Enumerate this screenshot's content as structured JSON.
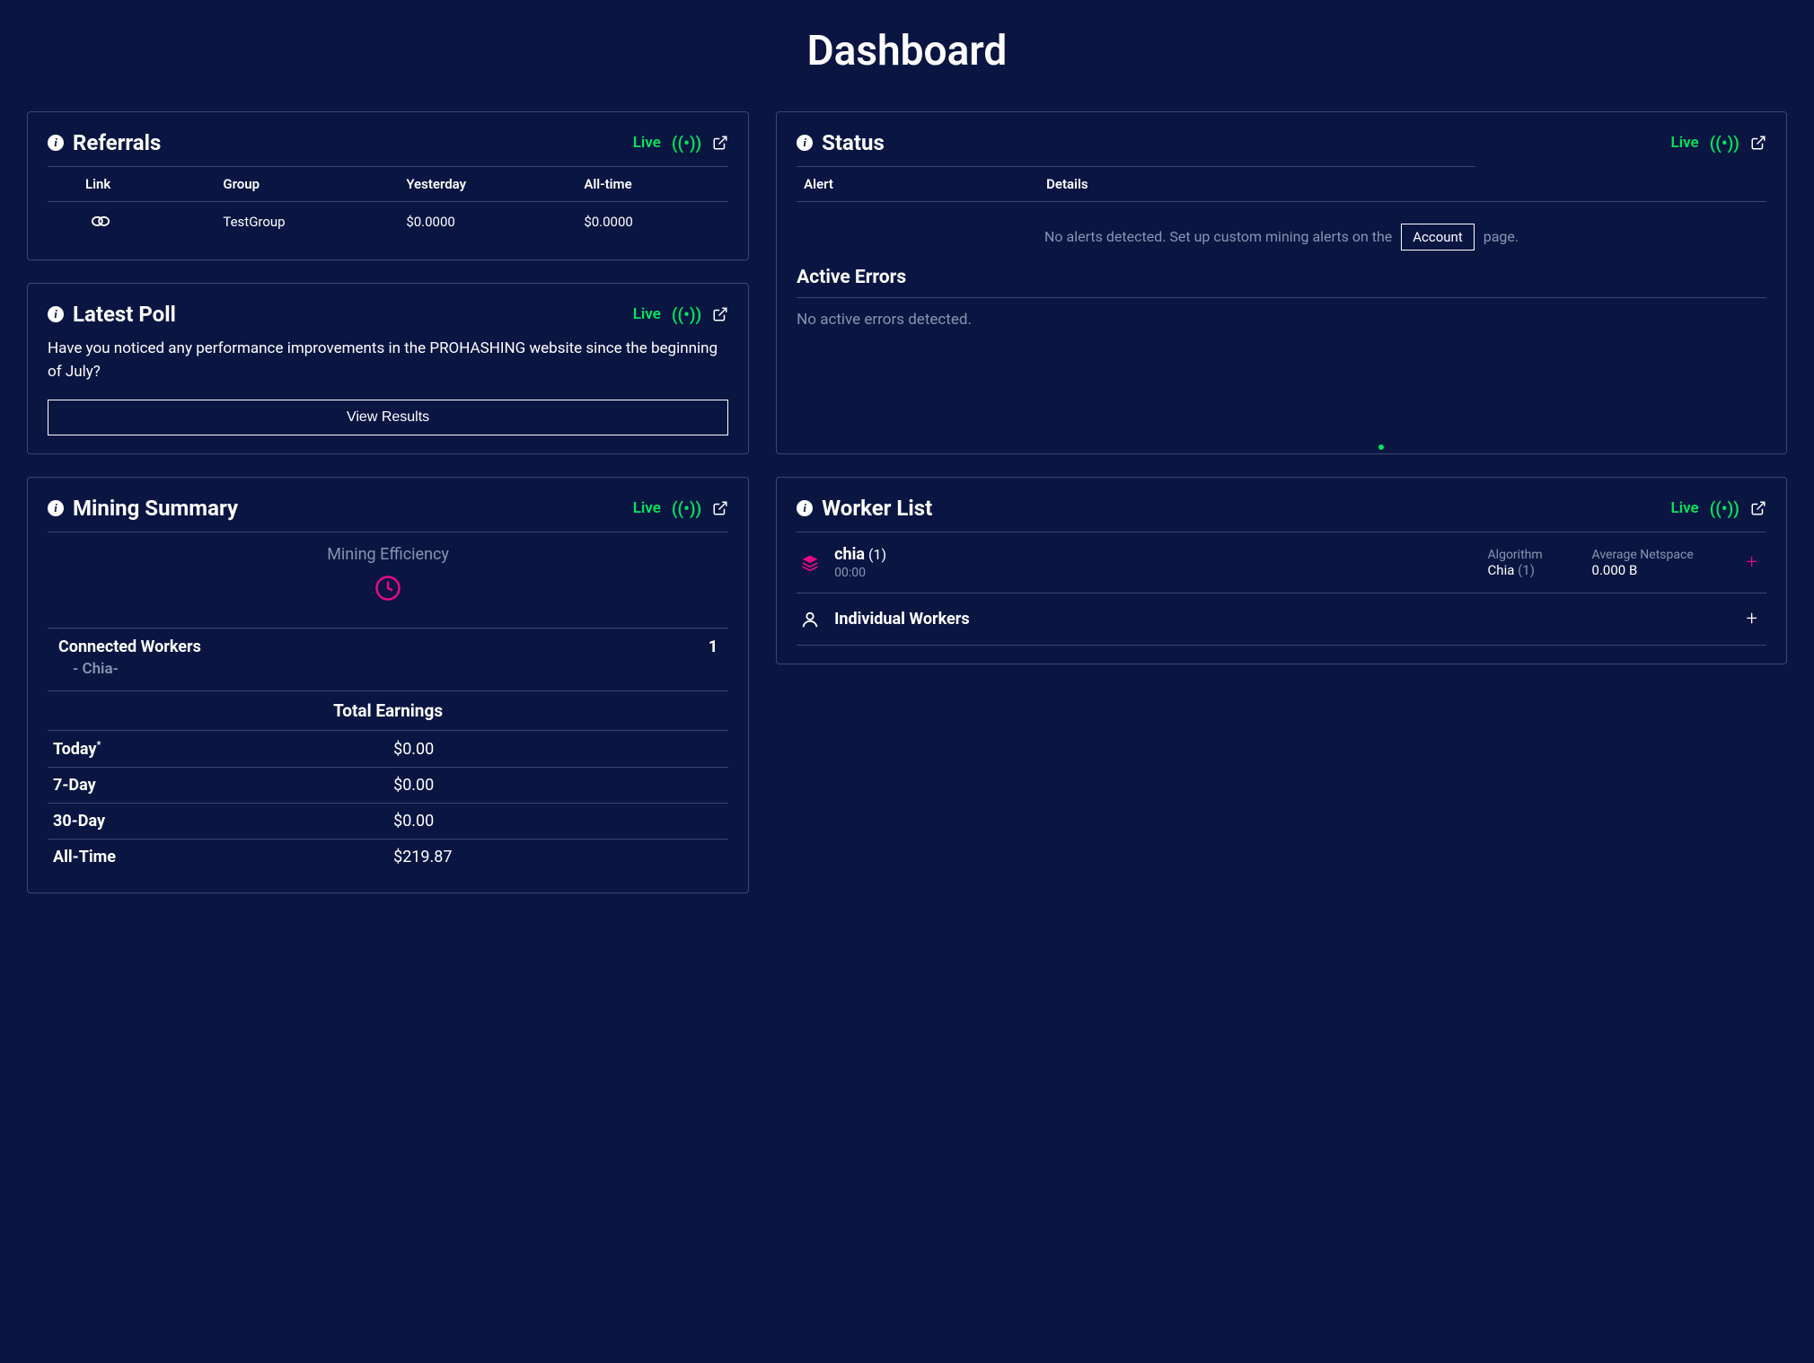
{
  "page": {
    "title": "Dashboard"
  },
  "live_label": "Live",
  "referrals": {
    "title": "Referrals",
    "headers": {
      "link": "Link",
      "group": "Group",
      "yesterday": "Yesterday",
      "alltime": "All-time"
    },
    "rows": [
      {
        "group": "TestGroup",
        "yesterday": "$0.0000",
        "alltime": "$0.0000"
      }
    ]
  },
  "poll": {
    "title": "Latest Poll",
    "question": "Have you noticed any performance improvements in the PROHASHING website since the beginning of July?",
    "view_results": "View Results"
  },
  "status": {
    "title": "Status",
    "headers": {
      "alert": "Alert",
      "details": "Details"
    },
    "no_alerts_prefix": "No alerts detected. Set up custom mining alerts on the",
    "account_btn": "Account",
    "no_alerts_suffix": "page.",
    "active_errors_title": "Active Errors",
    "no_errors": "No active errors detected."
  },
  "mining": {
    "title": "Mining Summary",
    "efficiency_label": "Mining Efficiency",
    "connected_workers_label": "Connected Workers",
    "connected_workers_count": "1",
    "coin_row": "- Chia-",
    "earnings_title": "Total Earnings",
    "rows": {
      "today_label": "Today",
      "today_value": "$0.00",
      "seven_label": "7-Day",
      "seven_value": "$0.00",
      "thirty_label": "30-Day",
      "thirty_value": "$0.00",
      "all_label": "All-Time",
      "all_value": "$219.87"
    }
  },
  "workerlist": {
    "title": "Worker List",
    "worker": {
      "name": "chia",
      "count": "(1)",
      "time": "00:00",
      "algo_label": "Algorithm",
      "algo_value": "Chia",
      "algo_count": "(1)",
      "netspace_label": "Average Netspace",
      "netspace_value": "0.000 B"
    },
    "individual_label": "Individual Workers"
  }
}
